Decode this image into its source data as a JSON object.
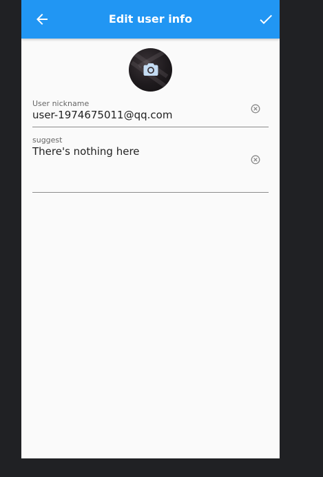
{
  "appbar": {
    "title": "Edit user info",
    "back_icon": "arrow-back-icon",
    "confirm_icon": "check-icon",
    "color": "#2196f3"
  },
  "avatar": {
    "icon": "camera-icon"
  },
  "form": {
    "nickname": {
      "label": "User nickname",
      "value": "user-1974675011@qq.com",
      "clear_icon": "clear-circle-icon"
    },
    "suggest": {
      "label": "suggest",
      "value": "There's nothing here",
      "clear_icon": "clear-circle-icon"
    }
  }
}
